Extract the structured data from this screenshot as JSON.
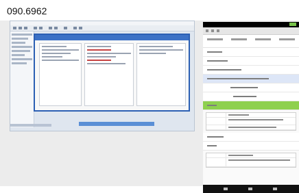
{
  "caption": "090.6962"
}
